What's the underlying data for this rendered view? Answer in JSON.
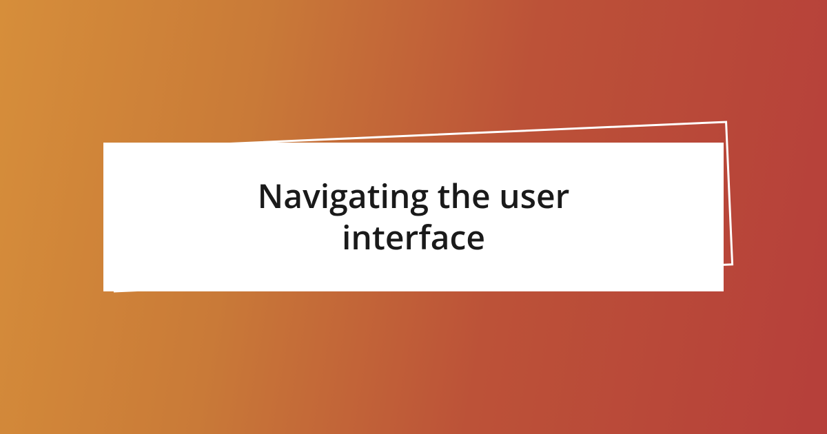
{
  "title": "Navigating the user interface"
}
